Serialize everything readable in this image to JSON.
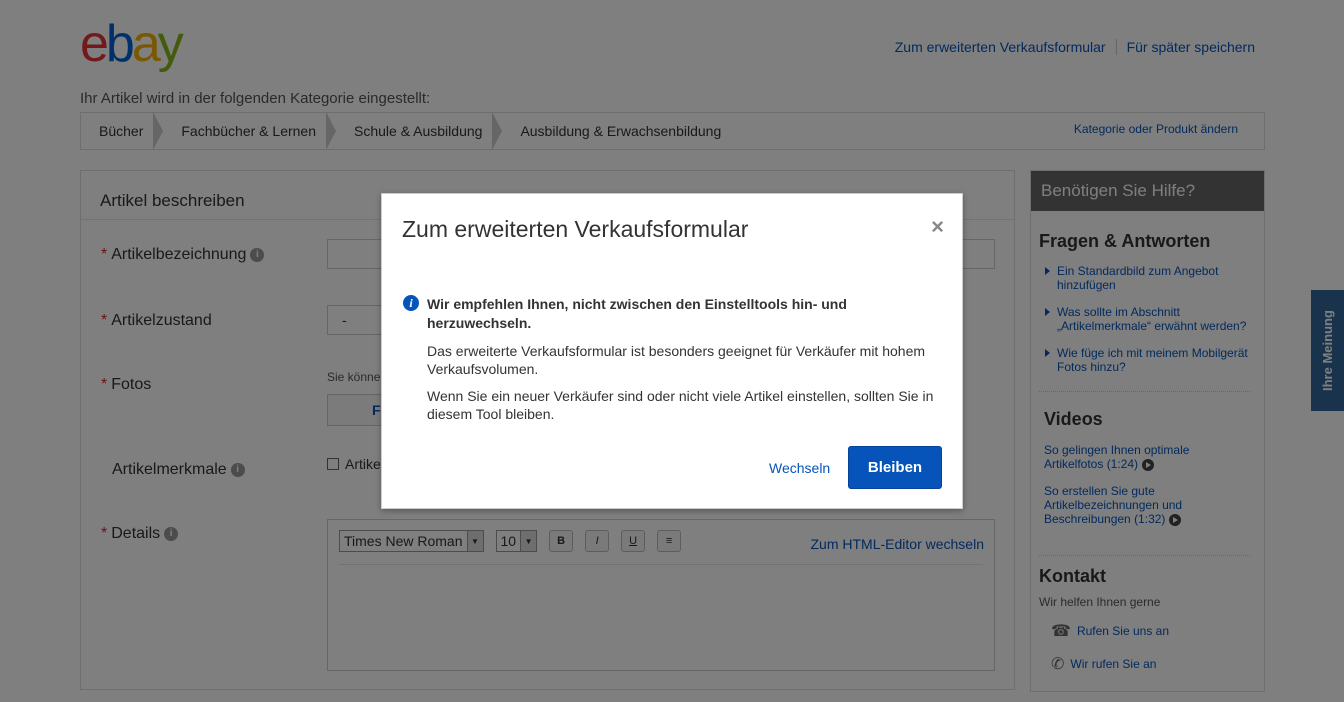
{
  "header": {
    "logo_letters": [
      "e",
      "b",
      "a",
      "y"
    ],
    "links": [
      "Zum erweiterten Verkaufsformular",
      "Für später speichern"
    ]
  },
  "category": {
    "label": "Ihr Artikel wird in der folgenden Kategorie eingestellt:",
    "crumbs": [
      "Bücher",
      "Fachbücher & Lernen",
      "Schule & Ausbildung",
      "Ausbildung & Erwachsenbildung"
    ],
    "change_link": "Kategorie oder Produkt ändern"
  },
  "form": {
    "title": "Artikel beschreiben",
    "fields": {
      "title_label": "Artikelbezeichnung",
      "condition_label": "Artikelzustand",
      "condition_value": "-",
      "photos_label": "Fotos",
      "photos_note": "Sie können",
      "photos_button": "F",
      "features_label": "Artikelmerkmale",
      "features_checkbox": "Artike",
      "details_label": "Details"
    },
    "editor": {
      "font": "Times New Roman",
      "size": "10",
      "bold": "B",
      "italic": "I",
      "underline": "U",
      "list": "≡",
      "html_link": "Zum HTML-Editor wechseln"
    },
    "required_mark": "*",
    "info_mark": "i"
  },
  "sidebar": {
    "help_title": "Benötigen Sie Hilfe?",
    "faq_title": "Fragen & Antworten",
    "faq": [
      "Ein Standardbild zum Angebot hinzufügen",
      "Was sollte im Abschnitt „Artikelmerkmale“ erwähnt werden?",
      "Wie füge ich mit meinem Mobilgerät Fotos hinzu?"
    ],
    "videos_title": "Videos",
    "videos": [
      "So gelingen Ihnen optimale Artikelfotos (1:24)",
      "So erstellen Sie gute Artikelbezeichnungen und Beschreibungen (1:32)"
    ],
    "contact_title": "Kontakt",
    "contact_sub": "Wir helfen Ihnen gerne",
    "contact_links": [
      "Rufen Sie uns an",
      "Wir rufen Sie an"
    ]
  },
  "feedback_tab": "Ihre Meinung",
  "modal": {
    "title": "Zum erweiterten Verkaufsformular",
    "close": "×",
    "info_icon": "i",
    "strong": "Wir empfehlen Ihnen, nicht zwischen den Einstelltools hin- und herzuwechseln.",
    "p1": "Das erweiterte Verkaufsformular ist besonders geeignet für Verkäufer mit hohem Verkaufsvolumen.",
    "p2": "Wenn Sie ein neuer Verkäufer sind oder nicht viele Artikel einstellen, sollten Sie in diesem Tool bleiben.",
    "switch_label": "Wechseln",
    "stay_label": "Bleiben"
  },
  "colors": {
    "link": "#0654ba",
    "primary_button": "#0654ba",
    "required": "#dd1e31",
    "overlay": "rgba(0,0,0,0.5)"
  }
}
